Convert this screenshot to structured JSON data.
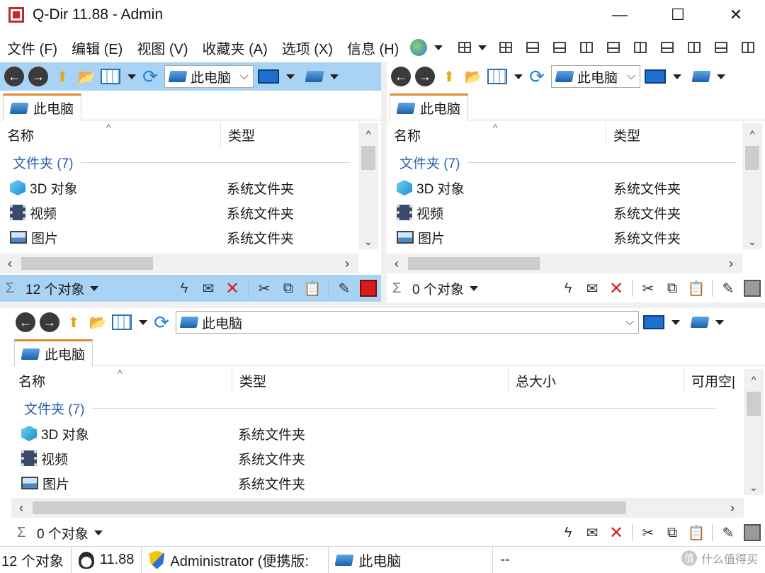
{
  "window": {
    "title": "Q-Dir 11.88 - Admin",
    "minimize": "—",
    "maximize": "☐",
    "close": "✕"
  },
  "menu": [
    "文件 (F)",
    "编辑 (E)",
    "视图 (V)",
    "收藏夹 (A)",
    "选项 (X)",
    "信息 (H)"
  ],
  "panes": {
    "top_left": {
      "address": "此电脑",
      "tab": "此电脑",
      "columns": [
        "名称",
        "类型"
      ],
      "group": "文件夹 (7)",
      "rows": [
        {
          "name": "3D 对象",
          "type": "系统文件夹",
          "icon": "3d-objects-icon"
        },
        {
          "name": "视频",
          "type": "系统文件夹",
          "icon": "video-icon"
        },
        {
          "name": "图片",
          "type": "系统文件夹",
          "icon": "pictures-icon"
        }
      ],
      "status": "12 个对象"
    },
    "top_right": {
      "address": "此电脑",
      "tab": "此电脑",
      "columns": [
        "名称",
        "类型"
      ],
      "group": "文件夹 (7)",
      "rows": [
        {
          "name": "3D 对象",
          "type": "系统文件夹",
          "icon": "3d-objects-icon"
        },
        {
          "name": "视频",
          "type": "系统文件夹",
          "icon": "video-icon"
        },
        {
          "name": "图片",
          "type": "系统文件夹",
          "icon": "pictures-icon"
        }
      ],
      "status": "0 个对象"
    },
    "bottom": {
      "address": "此电脑",
      "tab": "此电脑",
      "columns": [
        "名称",
        "类型",
        "总大小",
        "可用空|"
      ],
      "group": "文件夹 (7)",
      "rows": [
        {
          "name": "3D 对象",
          "type": "系统文件夹",
          "icon": "3d-objects-icon"
        },
        {
          "name": "视频",
          "type": "系统文件夹",
          "icon": "video-icon"
        },
        {
          "name": "图片",
          "type": "系统文件夹",
          "icon": "pictures-icon"
        }
      ],
      "status": "0 个对象"
    }
  },
  "statusbar": {
    "objects": "12 个对象",
    "version": "11.88",
    "user": "Administrator (便携版:",
    "location": "此电脑",
    "extra": "--"
  },
  "watermark": "什么值得买",
  "colors": {
    "active_pane": "#a9d3f5",
    "tab_accent": "#e08a2e",
    "group_text": "#2a5fb0",
    "delete_red": "#d32020"
  }
}
